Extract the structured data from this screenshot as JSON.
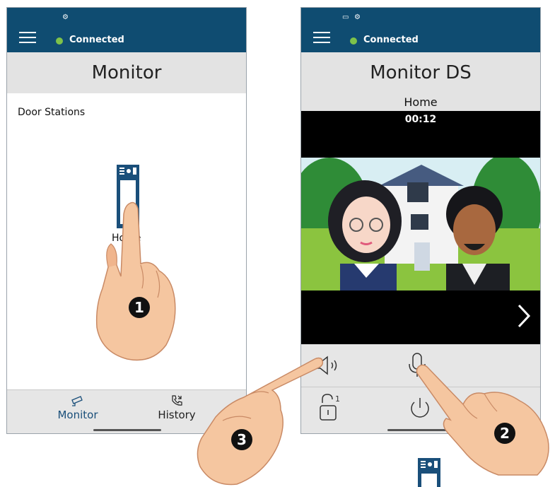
{
  "left_screen": {
    "status": {
      "label": "Connected"
    },
    "title": "Monitor",
    "section_label": "Door Stations",
    "door_station": {
      "name": "Home"
    },
    "nav": [
      {
        "label": "Monitor",
        "icon": "camera-icon"
      },
      {
        "label": "History",
        "icon": "phone-history-icon"
      }
    ]
  },
  "right_screen": {
    "status": {
      "label": "Connected"
    },
    "title": "Monitor DS",
    "place": "Home",
    "timer": "00:12",
    "controls": {
      "row1": [
        "speaker-icon",
        "microphone-icon"
      ],
      "row2": [
        "unlock-1-icon",
        "power-icon"
      ],
      "unlock_number": "1"
    }
  },
  "callouts": [
    {
      "number": "1"
    },
    {
      "number": "2"
    },
    {
      "number": "3"
    }
  ],
  "colors": {
    "topbar": "#0f4c71",
    "connected_dot": "#7ec24a",
    "title_bg": "#e3e3e3",
    "icon_blue": "#1a4f7a"
  }
}
